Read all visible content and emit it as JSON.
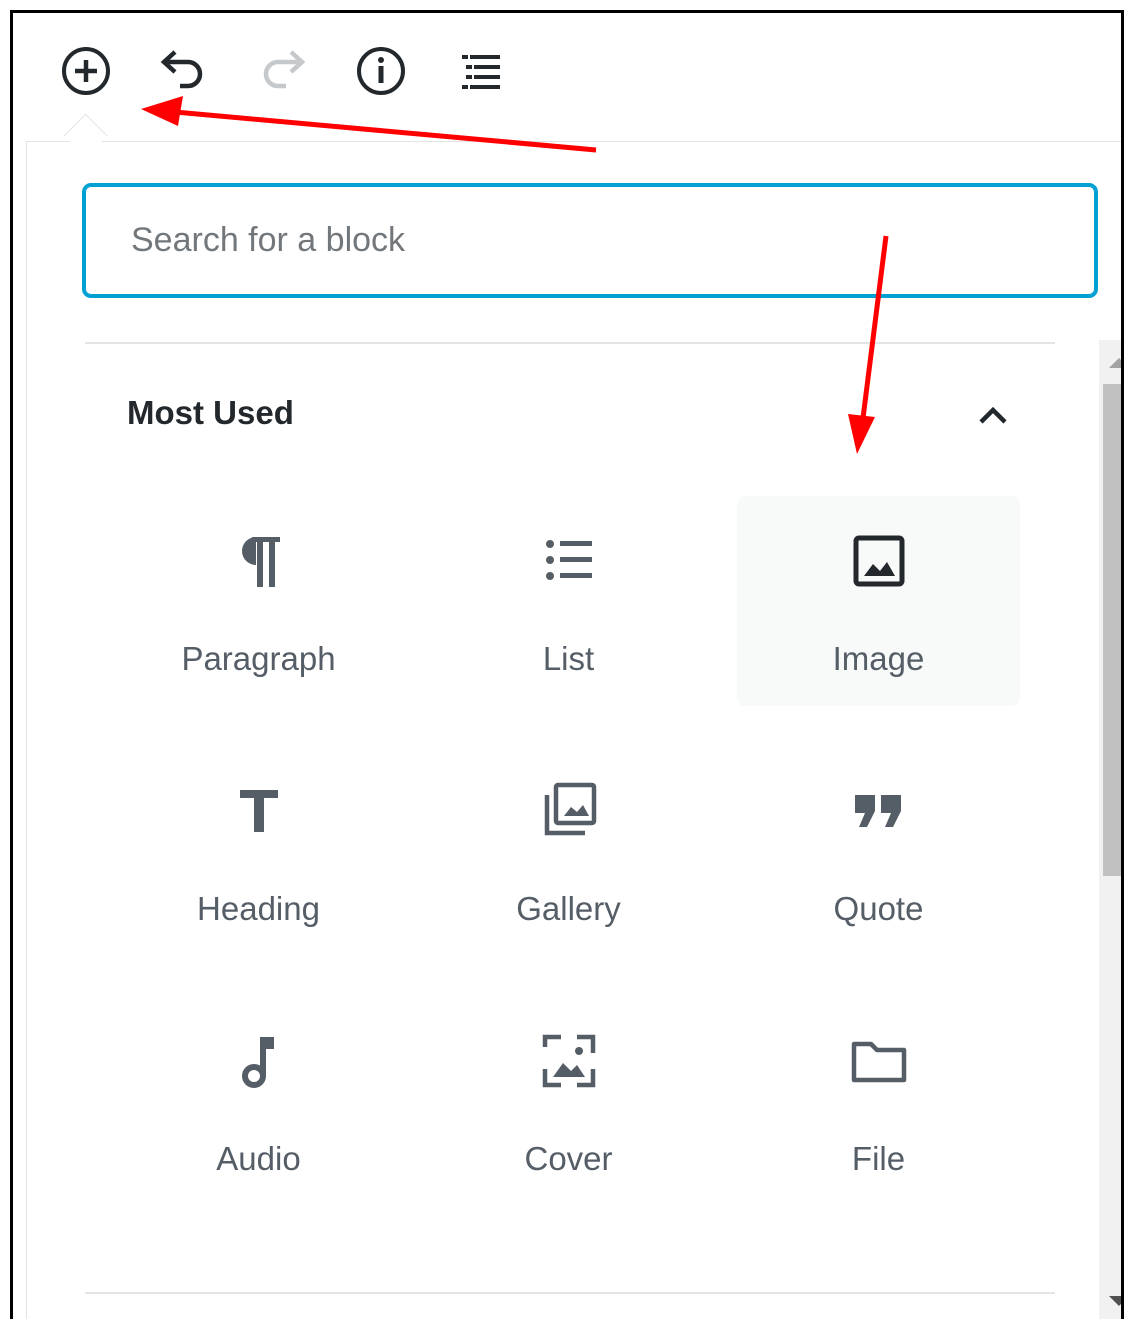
{
  "toolbar": {
    "buttons": [
      {
        "name": "add-block",
        "icon": "plus-circle-icon"
      },
      {
        "name": "undo",
        "icon": "undo-icon"
      },
      {
        "name": "redo",
        "icon": "redo-icon",
        "disabled": true
      },
      {
        "name": "info",
        "icon": "info-icon"
      },
      {
        "name": "outline",
        "icon": "list-outline-icon"
      }
    ]
  },
  "search": {
    "placeholder": "Search for a block",
    "value": ""
  },
  "section": {
    "title": "Most Used",
    "expanded": true
  },
  "blocks": [
    {
      "label": "Paragraph",
      "icon": "paragraph-icon"
    },
    {
      "label": "List",
      "icon": "list-icon"
    },
    {
      "label": "Image",
      "icon": "image-icon",
      "highlighted": true
    },
    {
      "label": "Heading",
      "icon": "heading-icon"
    },
    {
      "label": "Gallery",
      "icon": "gallery-icon"
    },
    {
      "label": "Quote",
      "icon": "quote-icon"
    },
    {
      "label": "Audio",
      "icon": "audio-icon"
    },
    {
      "label": "Cover",
      "icon": "cover-icon"
    },
    {
      "label": "File",
      "icon": "file-icon"
    }
  ],
  "colors": {
    "accent": "#00a0d2",
    "icon": "#555d66",
    "annotation": "#ff0000"
  }
}
